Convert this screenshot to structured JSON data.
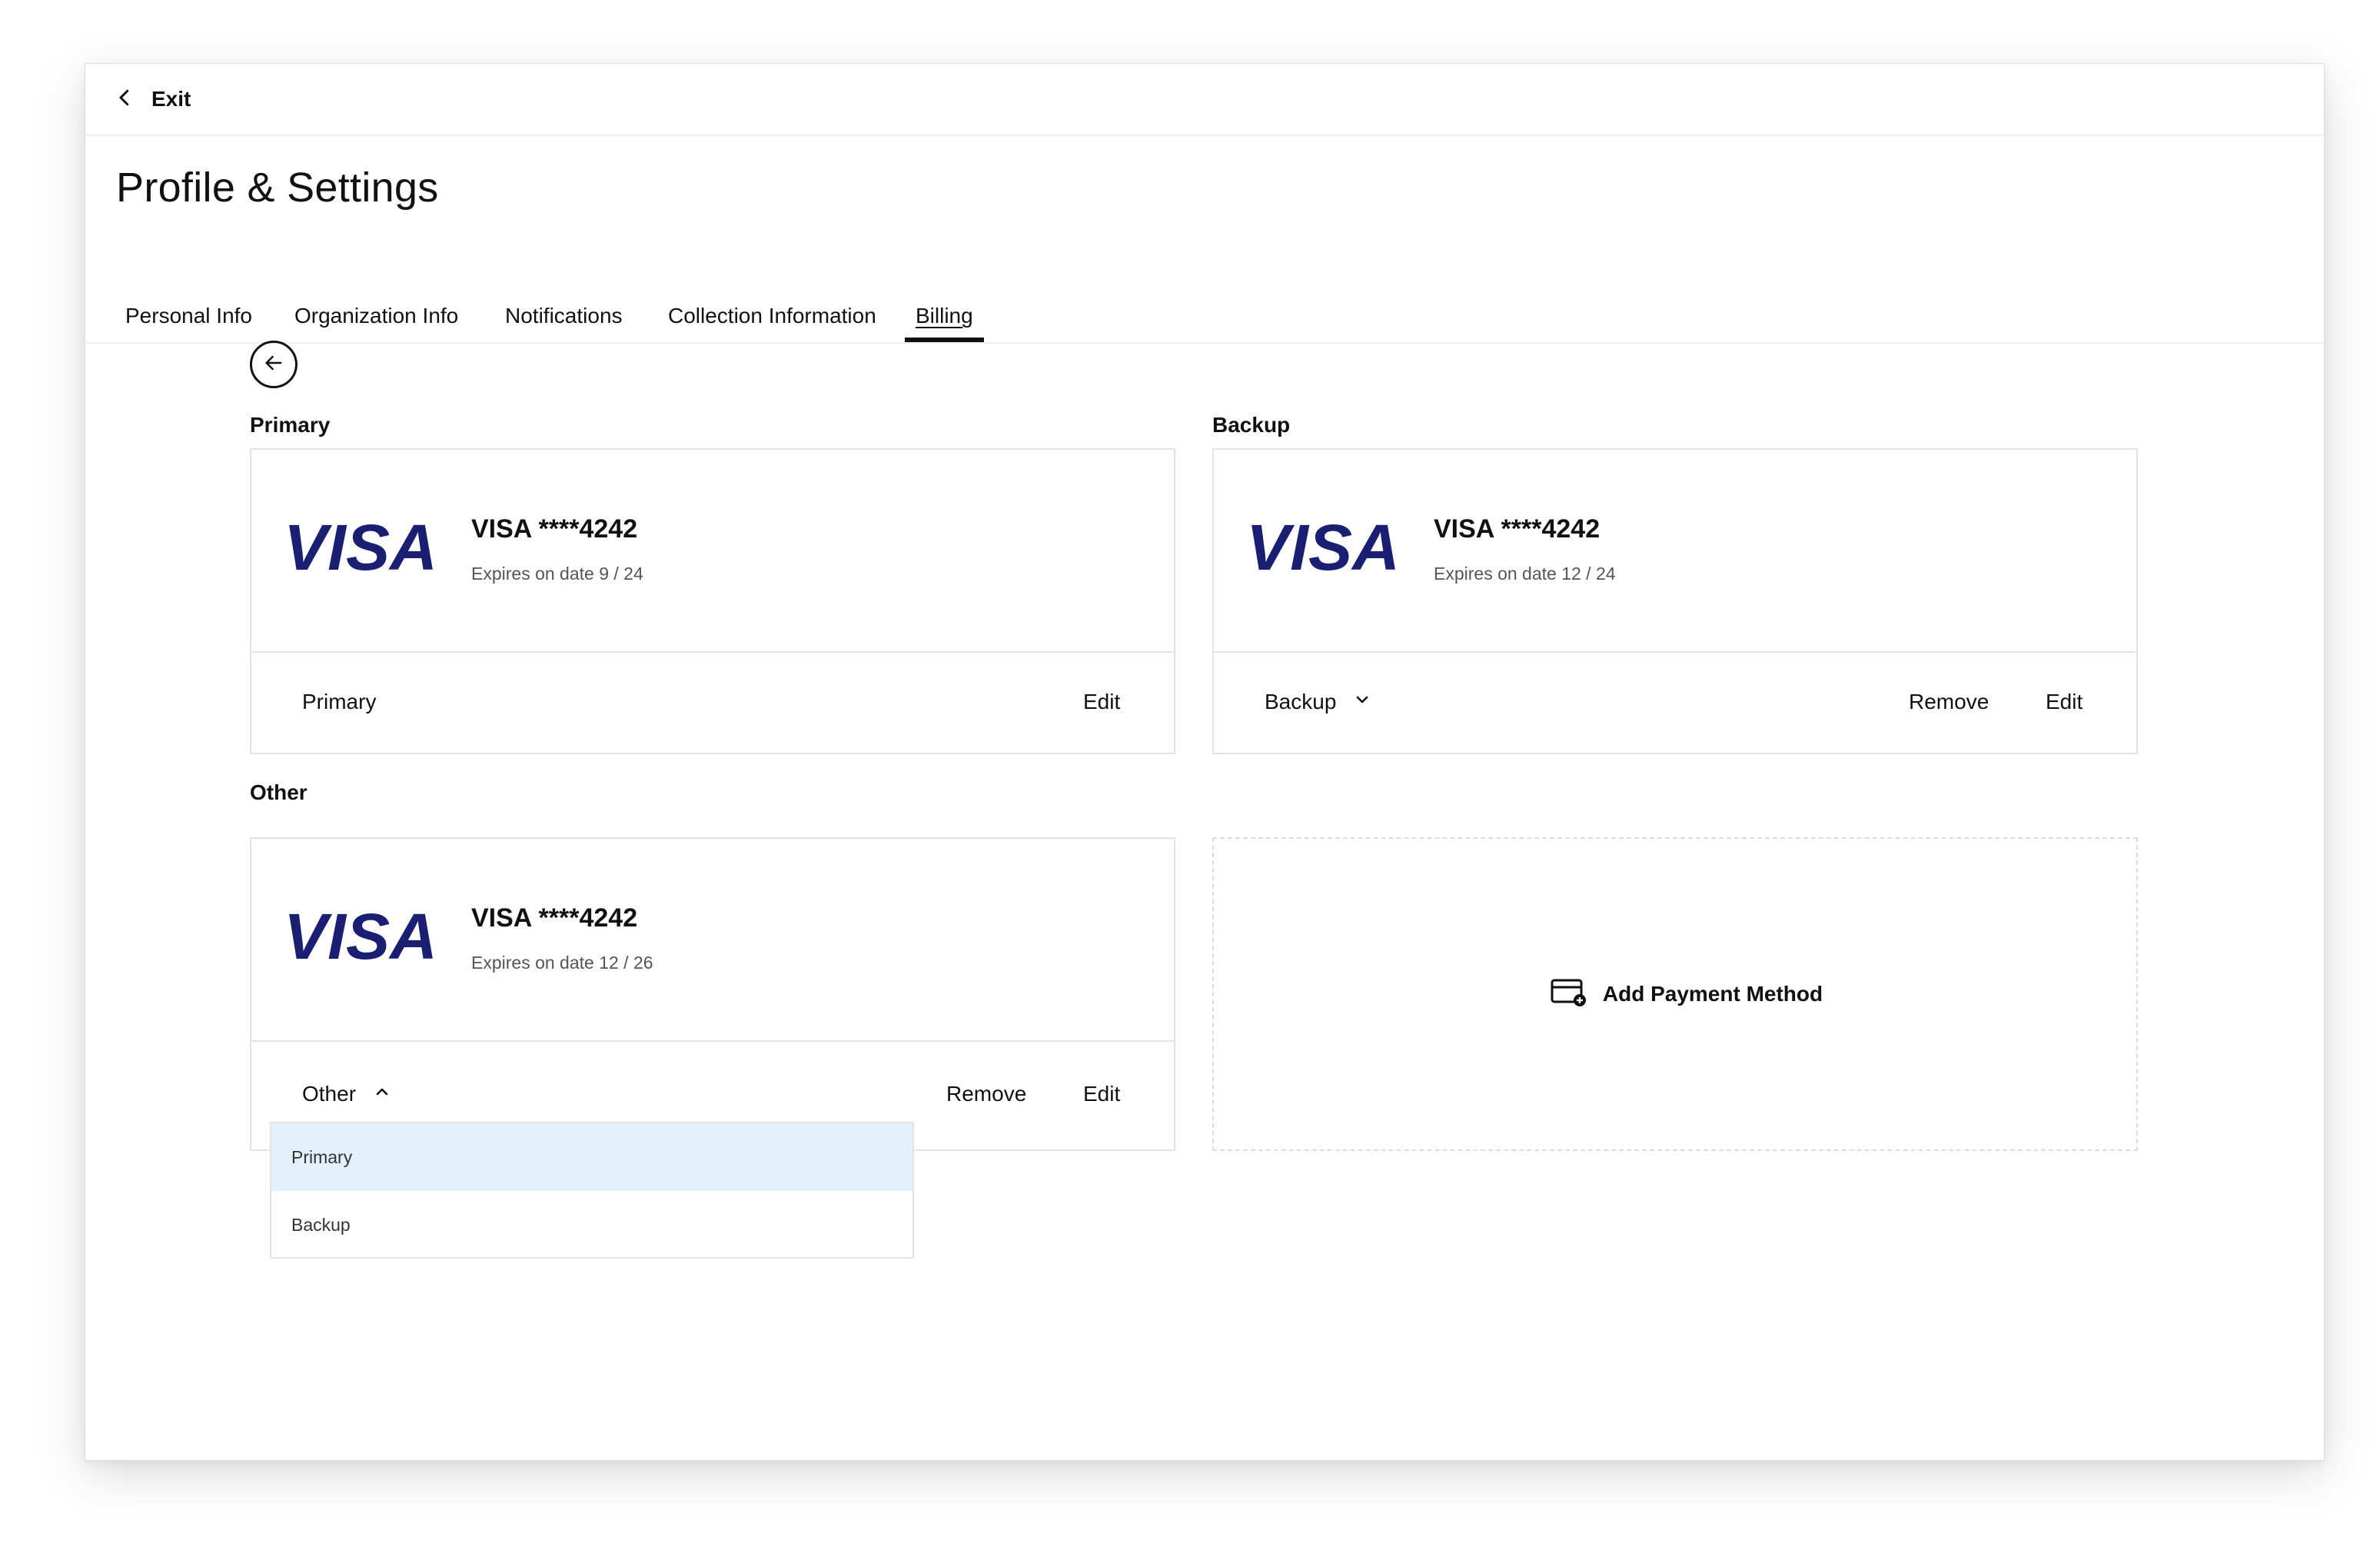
{
  "header": {
    "exit_label": "Exit"
  },
  "page": {
    "title": "Profile & Settings"
  },
  "tabs": [
    {
      "label": "Personal Info",
      "active": false
    },
    {
      "label": "Organization Info",
      "active": false
    },
    {
      "label": "Notifications",
      "active": false
    },
    {
      "label": "Collection Information",
      "active": false
    },
    {
      "label": "Billing",
      "active": true
    }
  ],
  "sections": {
    "primary": "Primary",
    "backup": "Backup",
    "other": "Other"
  },
  "cards": {
    "primary": {
      "brand": "VISA",
      "name": "VISA ****4242",
      "expiry": "Expires on date 9 / 24",
      "status": "Primary",
      "edit": "Edit"
    },
    "backup": {
      "brand": "VISA",
      "name": "VISA ****4242",
      "expiry": "Expires on date 12 / 24",
      "status": "Backup",
      "remove": "Remove",
      "edit": "Edit"
    },
    "other": {
      "brand": "VISA",
      "name": "VISA ****4242",
      "expiry": "Expires on date 12 / 26",
      "status": "Other",
      "remove": "Remove",
      "edit": "Edit"
    }
  },
  "dropdown": {
    "options": [
      "Primary",
      "Backup"
    ],
    "highlighted": "Primary"
  },
  "add_payment": {
    "label": "Add Payment Method"
  },
  "colors": {
    "visa_blue": "#1a1f71",
    "dropdown_highlight": "#e3f1fa"
  },
  "icons": {
    "exit": "chevron-left-icon",
    "back": "arrow-left-icon",
    "backup_dropdown": "chevron-down-icon",
    "other_dropdown": "chevron-up-icon",
    "add_payment": "credit-card-plus-icon"
  }
}
